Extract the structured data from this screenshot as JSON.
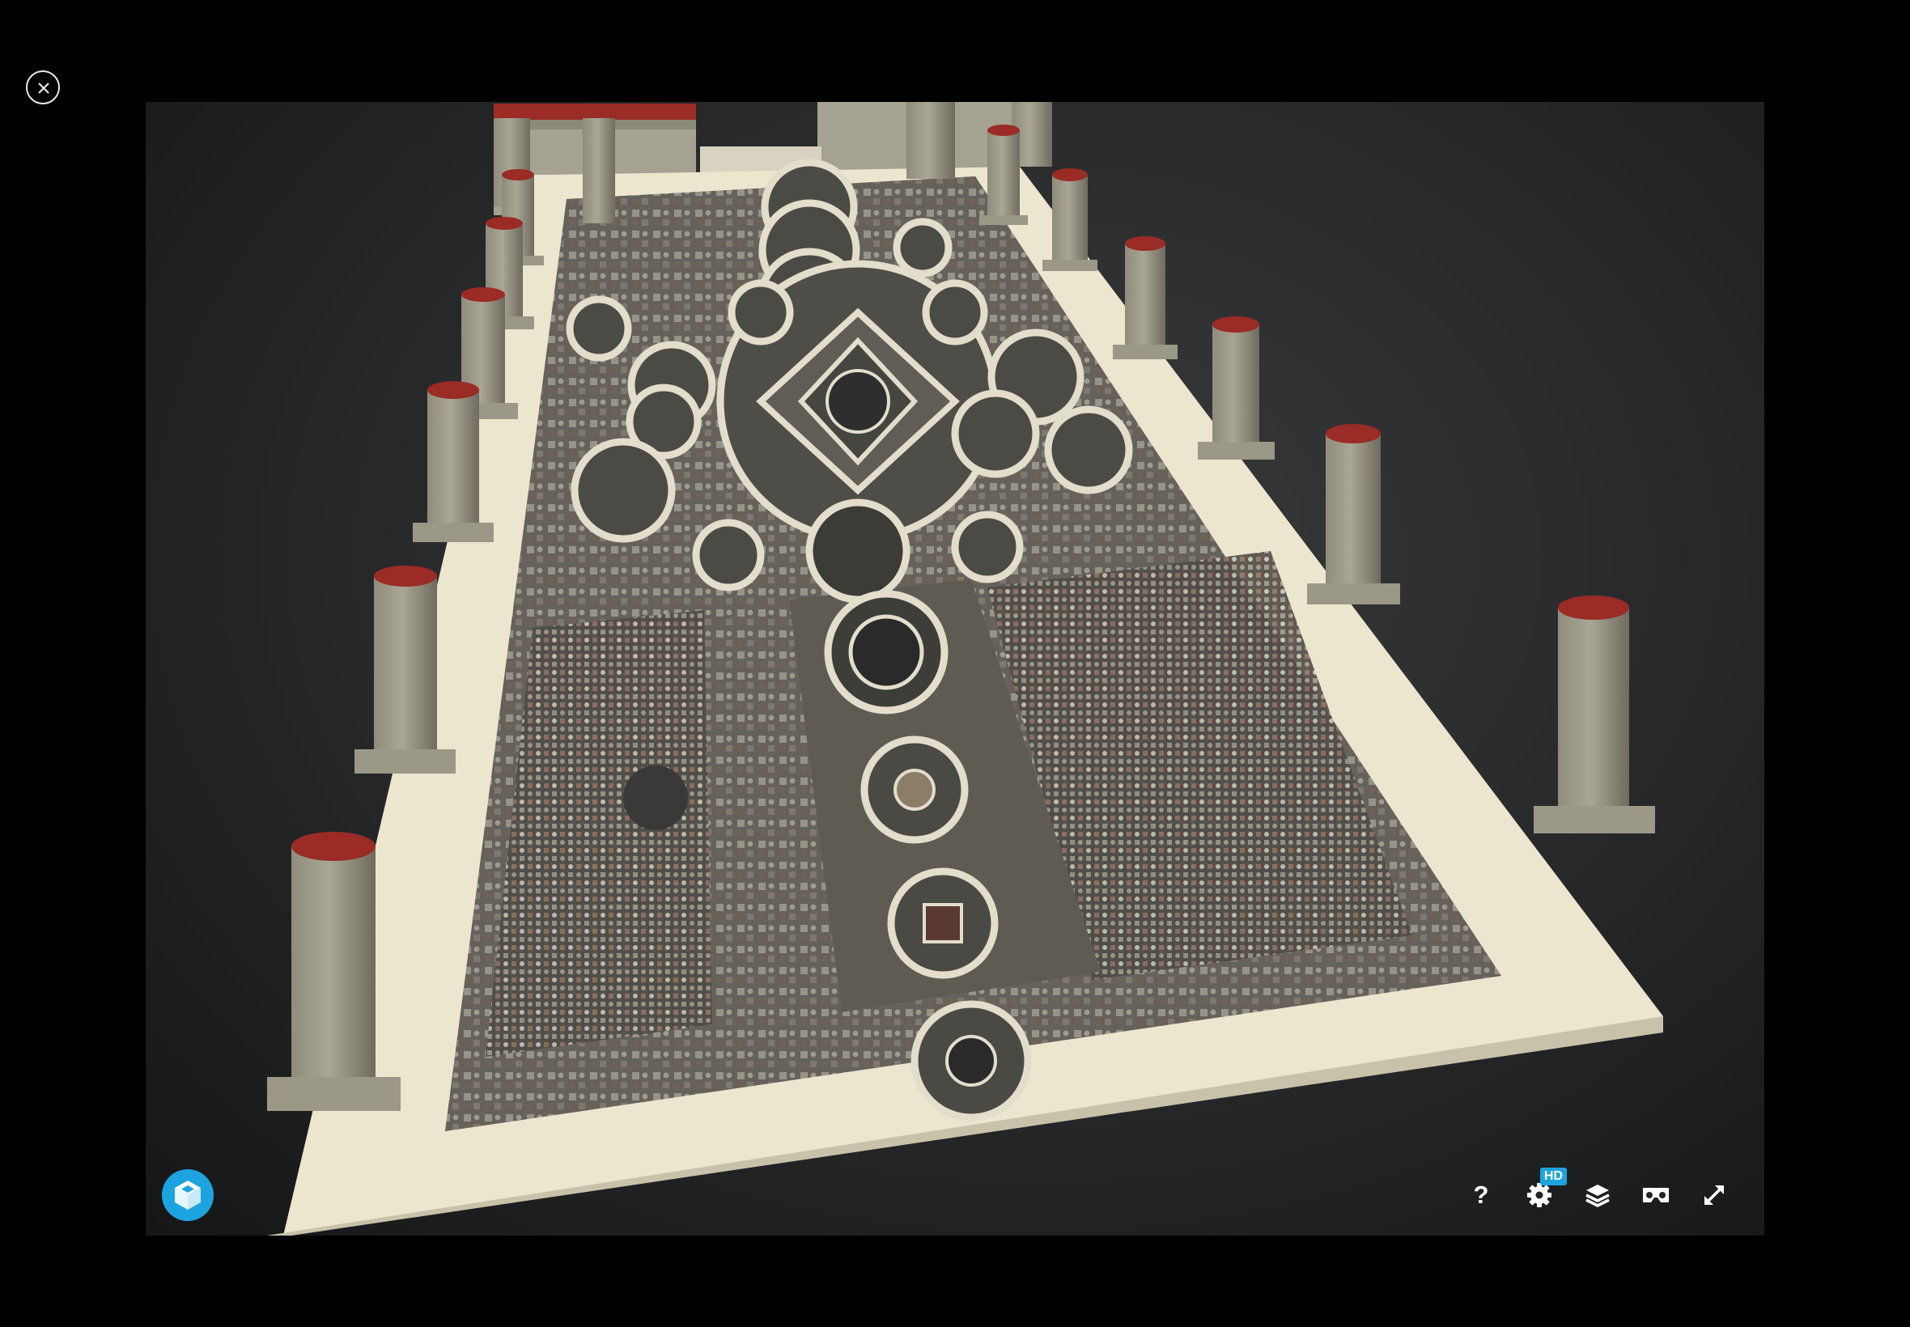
{
  "viewer": {
    "title": "",
    "accent_color": "#1ca4e0",
    "column_cap_color": "#9a2b25"
  },
  "close": {
    "icon": "close-icon"
  },
  "logo": {
    "icon": "sketchfab-cube-icon"
  },
  "toolbar": {
    "help_label": "?",
    "settings_badge": "HD",
    "icons": [
      "help-icon",
      "settings-gear-icon",
      "layers-icon",
      "vr-headset-icon",
      "fullscreen-icon"
    ]
  }
}
